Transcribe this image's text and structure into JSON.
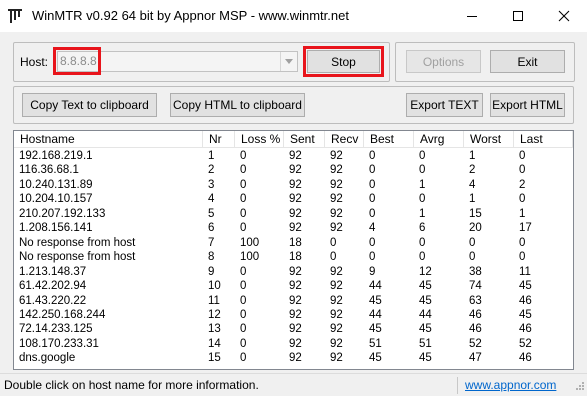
{
  "window": {
    "title": "WinMTR v0.92 64 bit by Appnor MSP - www.winmtr.net",
    "icon": "winmtr-app-icon"
  },
  "controls": {
    "host_label": "Host:",
    "host_value": "8.8.8.8",
    "stop_label": "Stop",
    "options_label": "Options",
    "exit_label": "Exit",
    "copy_text_label": "Copy Text to clipboard",
    "copy_html_label": "Copy HTML to clipboard",
    "export_text_label": "Export TEXT",
    "export_html_label": "Export HTML"
  },
  "table": {
    "columns": [
      "Hostname",
      "Nr",
      "Loss %",
      "Sent",
      "Recv",
      "Best",
      "Avrg",
      "Worst",
      "Last"
    ],
    "rows": [
      [
        "192.168.219.1",
        "1",
        "0",
        "92",
        "92",
        "0",
        "0",
        "1",
        "0"
      ],
      [
        "116.36.68.1",
        "2",
        "0",
        "92",
        "92",
        "0",
        "0",
        "2",
        "0"
      ],
      [
        "10.240.131.89",
        "3",
        "0",
        "92",
        "92",
        "0",
        "1",
        "4",
        "2"
      ],
      [
        "10.204.10.157",
        "4",
        "0",
        "92",
        "92",
        "0",
        "0",
        "1",
        "0"
      ],
      [
        "210.207.192.133",
        "5",
        "0",
        "92",
        "92",
        "0",
        "1",
        "15",
        "1"
      ],
      [
        "1.208.156.141",
        "6",
        "0",
        "92",
        "92",
        "4",
        "6",
        "20",
        "17"
      ],
      [
        "No response from host",
        "7",
        "100",
        "18",
        "0",
        "0",
        "0",
        "0",
        "0"
      ],
      [
        "No response from host",
        "8",
        "100",
        "18",
        "0",
        "0",
        "0",
        "0",
        "0"
      ],
      [
        "1.213.148.37",
        "9",
        "0",
        "92",
        "92",
        "9",
        "12",
        "38",
        "11"
      ],
      [
        "61.42.202.94",
        "10",
        "0",
        "92",
        "92",
        "44",
        "45",
        "74",
        "45"
      ],
      [
        "61.43.220.22",
        "11",
        "0",
        "92",
        "92",
        "45",
        "45",
        "63",
        "46"
      ],
      [
        "142.250.168.244",
        "12",
        "0",
        "92",
        "92",
        "44",
        "44",
        "46",
        "45"
      ],
      [
        "72.14.233.125",
        "13",
        "0",
        "92",
        "92",
        "45",
        "45",
        "46",
        "46"
      ],
      [
        "108.170.233.31",
        "14",
        "0",
        "92",
        "92",
        "51",
        "51",
        "52",
        "52"
      ],
      [
        "dns.google",
        "15",
        "0",
        "92",
        "92",
        "45",
        "45",
        "47",
        "46"
      ]
    ]
  },
  "status": {
    "message": "Double click on host name for more information.",
    "link": "www.appnor.com"
  },
  "colors": {
    "highlight": "#e8141b",
    "link": "#0066cc"
  }
}
